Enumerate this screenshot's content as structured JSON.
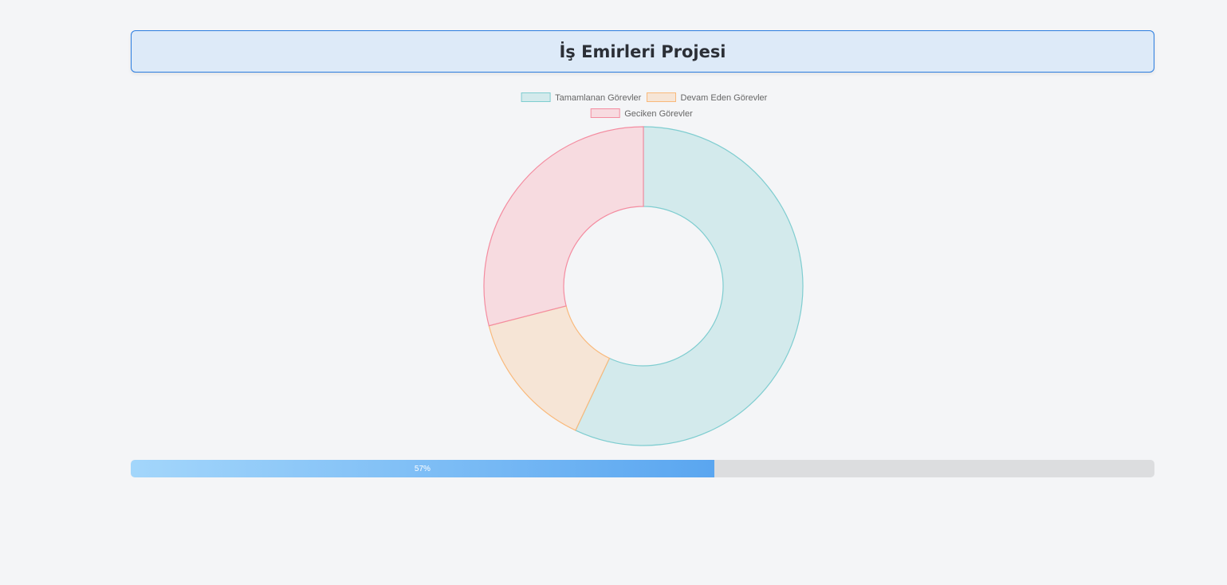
{
  "header": {
    "title": "İş Emirleri Projesi"
  },
  "chart_data": {
    "type": "doughnut",
    "labels": [
      "Tamamlanan Görevler",
      "Devam Eden Görevler",
      "Geciken Görevler"
    ],
    "values": [
      57,
      14,
      29
    ],
    "colors": {
      "fill": [
        "#d3eaec",
        "#f6e5d6",
        "#f7dbe0"
      ],
      "border": [
        "#7fcdd0",
        "#f9b97b",
        "#f48ca0"
      ]
    },
    "legend": "top"
  },
  "progress": {
    "value": 57,
    "label": "57%"
  }
}
